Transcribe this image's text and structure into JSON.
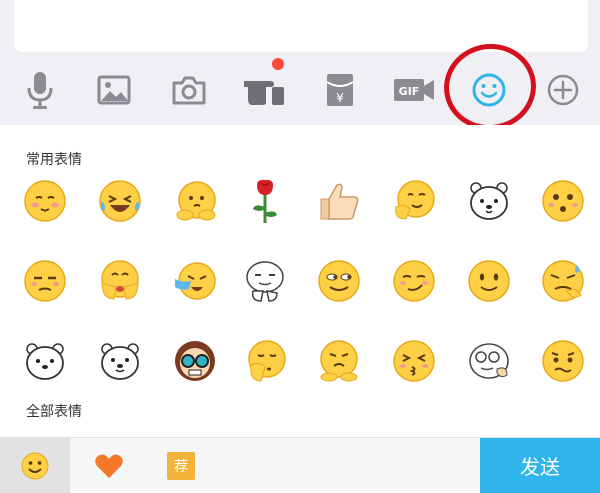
{
  "input": {
    "value": ""
  },
  "toolbar": {
    "items": [
      {
        "icon": "microphone-icon"
      },
      {
        "icon": "image-icon"
      },
      {
        "icon": "camera-icon"
      },
      {
        "icon": "poke-hand-icon",
        "badge": true
      },
      {
        "icon": "red-packet-icon",
        "label": "¥"
      },
      {
        "icon": "gif-icon",
        "label": "GIF"
      },
      {
        "icon": "emoji-icon",
        "active": true
      },
      {
        "icon": "plus-icon"
      }
    ],
    "accent": "#2fb5ec",
    "icon_color": "#8b8b93"
  },
  "emoji_panel": {
    "frequent_title": "常用表情",
    "all_title": "全部表情",
    "frequent": [
      [
        "blushing-smile",
        "laughing-tears",
        "shy-sweat",
        "rose",
        "thumbs-up",
        "hand-on-face",
        "polar-bear",
        "surprised-curious"
      ],
      [
        "unamused",
        "hands-covering-smile",
        "crying-waterfall",
        "doodle-thinking-face",
        "side-eye-grin",
        "smirk",
        "plain-smile",
        "sweating-sneer"
      ],
      [
        "polar-bear-2",
        "polar-bear-3",
        "cool-sunglasses",
        "shh-hand",
        "sad-pout",
        "kissy-face",
        "doodle-glasses-face",
        "worried-wavy"
      ]
    ]
  },
  "bottom_bar": {
    "tabs": [
      {
        "icon": "emoji-tab-icon",
        "active": true
      },
      {
        "icon": "heart-tab-icon"
      },
      {
        "icon": "recommend-tab-icon",
        "label": "荐"
      }
    ],
    "send_label": "发送"
  }
}
